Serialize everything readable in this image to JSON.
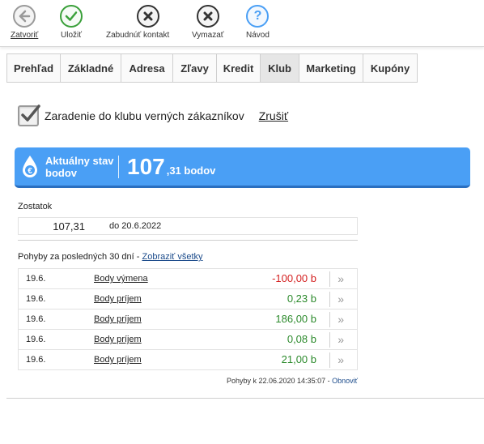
{
  "toolbar": {
    "close_label": "Zatvoriť",
    "save_label": "Uložiť",
    "forget_label": "Zabudnúť kontakt",
    "delete_label": "Vymazať",
    "help_label": "Návod"
  },
  "tabs": [
    {
      "label": "Prehľad"
    },
    {
      "label": "Základné"
    },
    {
      "label": "Adresa"
    },
    {
      "label": "Zľavy"
    },
    {
      "label": "Kredit"
    },
    {
      "label": "Klub"
    },
    {
      "label": "Marketing"
    },
    {
      "label": "Kupóny"
    }
  ],
  "membership": {
    "label": "Zaradenie do klubu verných zákazníkov",
    "cancel_label": "Zrušiť",
    "checked": true
  },
  "status": {
    "label": "Aktuálny stav bodov",
    "points_int": "107",
    "points_dec": ",31 bodov"
  },
  "balance": {
    "title": "Zostatok",
    "value": "107,31",
    "valid_until": "do 20.6.2022"
  },
  "movements": {
    "title": "Pohyby za posledných 30 dní - ",
    "show_all_label": "Zobraziť všetky",
    "rows": [
      {
        "date": "19.6.",
        "type": "Body výmena",
        "amount": "-100,00 b",
        "sign": "neg"
      },
      {
        "date": "19.6.",
        "type": "Body príjem",
        "amount": "0,23 b",
        "sign": "pos"
      },
      {
        "date": "19.6.",
        "type": "Body príjem",
        "amount": "186,00 b",
        "sign": "pos"
      },
      {
        "date": "19.6.",
        "type": "Body príjem",
        "amount": "0,08 b",
        "sign": "pos"
      },
      {
        "date": "19.6.",
        "type": "Body príjem",
        "amount": "21,00 b",
        "sign": "pos"
      }
    ],
    "arrow": "»"
  },
  "footer": {
    "updated_text": "Pohyby k 22.06.2020 14:35:07 - ",
    "refresh_label": "Obnoviť"
  },
  "colors": {
    "accent": "#4a9ff5",
    "negative": "#d42020",
    "positive": "#2c8a2c",
    "save_icon": "#3aa03a",
    "help_icon": "#4a9ff5"
  }
}
